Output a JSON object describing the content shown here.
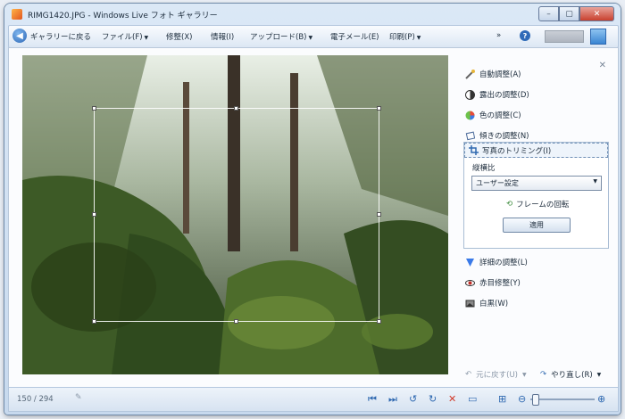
{
  "window": {
    "title": "RIMG1420.JPG - Windows Live フォト ギャラリー"
  },
  "menu": {
    "back": "ギャラリーに戻る",
    "items": [
      "ファイル(F)",
      "修整(X)",
      "情報(I)",
      "アップロード(B)",
      "電子メール(E)",
      "印刷(P)"
    ],
    "overflow": "»"
  },
  "panel": {
    "items": [
      {
        "label": "自動調整(A)",
        "icon": "wand-icon"
      },
      {
        "label": "露出の調整(D)",
        "icon": "exposure-icon"
      },
      {
        "label": "色の調整(C)",
        "icon": "color-icon"
      },
      {
        "label": "傾きの調整(N)",
        "icon": "straighten-icon"
      }
    ],
    "crop": {
      "header": "写真のトリミング(I)",
      "aspect_label": "縦横比",
      "aspect_value": "ユーザー設定",
      "rotate_label": "フレームの回転",
      "apply_label": "適用"
    },
    "items_after": [
      {
        "label": "詳細の調整(L)",
        "icon": "detail-icon"
      },
      {
        "label": "赤目修整(Y)",
        "icon": "redeye-icon"
      },
      {
        "label": "白黒(W)",
        "icon": "bw-icon"
      }
    ],
    "undo": "元に戻す(U)",
    "redo": "やり直し(R)"
  },
  "status": {
    "counter": "150 / 294"
  },
  "colors": {
    "accent": "#2e68b0",
    "window_frame": "#c7d9ee",
    "delete": "#d23a2a"
  }
}
